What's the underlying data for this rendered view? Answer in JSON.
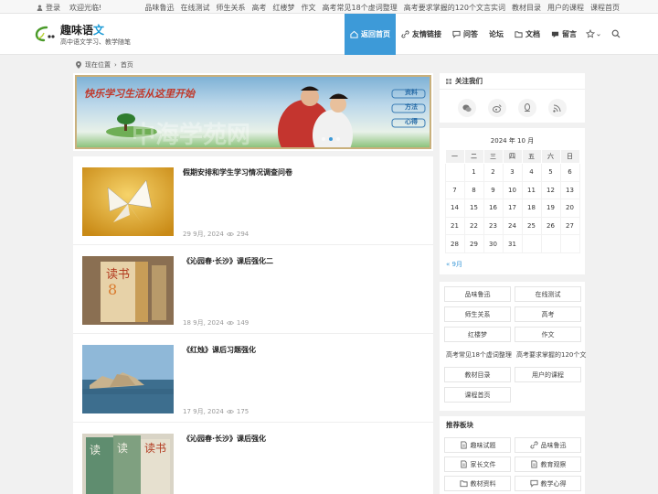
{
  "topbar": {
    "login": "登录",
    "welcome": "欢迎光临!",
    "links": [
      "品味鲁迅",
      "在线测试",
      "师生关系",
      "高考",
      "红楼梦",
      "作文",
      "高考常见18个虚词整理",
      "高考要求掌握的120个文言实词",
      "教材目录",
      "用户的课程",
      "课程首页"
    ]
  },
  "header": {
    "site_title_main": "趣味语",
    "site_title_accent": "文",
    "site_desc": "高中语文学习、教学随笔",
    "logo_icon": "quwei-yuwen-logo",
    "nav": [
      {
        "label": "返回首页",
        "icon": "home-icon",
        "active": true
      },
      {
        "label": "友情链接",
        "icon": "link-icon",
        "active": false
      },
      {
        "label": "问答",
        "icon": "chat-icon",
        "active": false
      },
      {
        "label": "论坛",
        "icon": "",
        "active": false
      },
      {
        "label": "文档",
        "icon": "folder-icon",
        "active": false
      },
      {
        "label": "留言",
        "icon": "message-icon",
        "active": false
      }
    ]
  },
  "breadcrumb": {
    "location": "现在位置",
    "home": "首页"
  },
  "slider": {
    "banner_text": "快乐学习生活从这里开始",
    "banner_tags": [
      "资料",
      "方法",
      "心得"
    ],
    "slide_count": 3,
    "active_slide": 1
  },
  "posts": [
    {
      "title": "假期安排和学生学习情况调查问卷",
      "date": "29 9月, 2024",
      "views": "294",
      "thumb": "paper-butterfly"
    },
    {
      "title": "《沁园春·长沙》课后强化二",
      "date": "18 9月, 2024",
      "views": "149",
      "thumb": "dushu-book"
    },
    {
      "title": "《红烛》课后习题强化",
      "date": "17 9月, 2024",
      "views": "175",
      "thumb": "seaside-rocks"
    },
    {
      "title": "《沁园春·长沙》课后强化",
      "date": "",
      "views": "",
      "thumb": "dushu-books-stack"
    }
  ],
  "sidebar": {
    "follow": {
      "title": "关注我们",
      "icons": [
        "wechat-icon",
        "weibo-icon",
        "qq-icon",
        "rss-icon"
      ]
    },
    "calendar": {
      "caption": "2024 年 10 月",
      "weekdays": [
        "一",
        "二",
        "三",
        "四",
        "五",
        "六",
        "日"
      ],
      "weeks": [
        [
          "",
          "1",
          "2",
          "3",
          "4",
          "5",
          "6"
        ],
        [
          "7",
          "8",
          "9",
          "10",
          "11",
          "12",
          "13"
        ],
        [
          "14",
          "15",
          "16",
          "17",
          "18",
          "19",
          "20"
        ],
        [
          "21",
          "22",
          "23",
          "24",
          "25",
          "26",
          "27"
        ],
        [
          "28",
          "29",
          "30",
          "31",
          "",
          "",
          ""
        ]
      ],
      "prev": "« 9月"
    },
    "tags": [
      "品味鲁迅",
      "在线测试",
      "师生关系",
      "高考",
      "红楼梦",
      "作文",
      "高考常见18个虚词整理",
      "高考要求掌握的120个文",
      "教材目录",
      "用户的课程",
      "课程首页"
    ],
    "recommend": {
      "title": "推荐板块",
      "items": [
        {
          "label": "趣味试题",
          "icon": "doc-icon"
        },
        {
          "label": "品味鲁迅",
          "icon": "link-icon"
        },
        {
          "label": "家长文件",
          "icon": "doc-icon"
        },
        {
          "label": "教育观察",
          "icon": "doc-icon"
        },
        {
          "label": "教材资料",
          "icon": "folder-icon"
        },
        {
          "label": "教学心得",
          "icon": "chat-icon"
        }
      ]
    }
  },
  "colors": {
    "accent": "#3d9ad8",
    "nav_active": "#3d9ad8"
  }
}
